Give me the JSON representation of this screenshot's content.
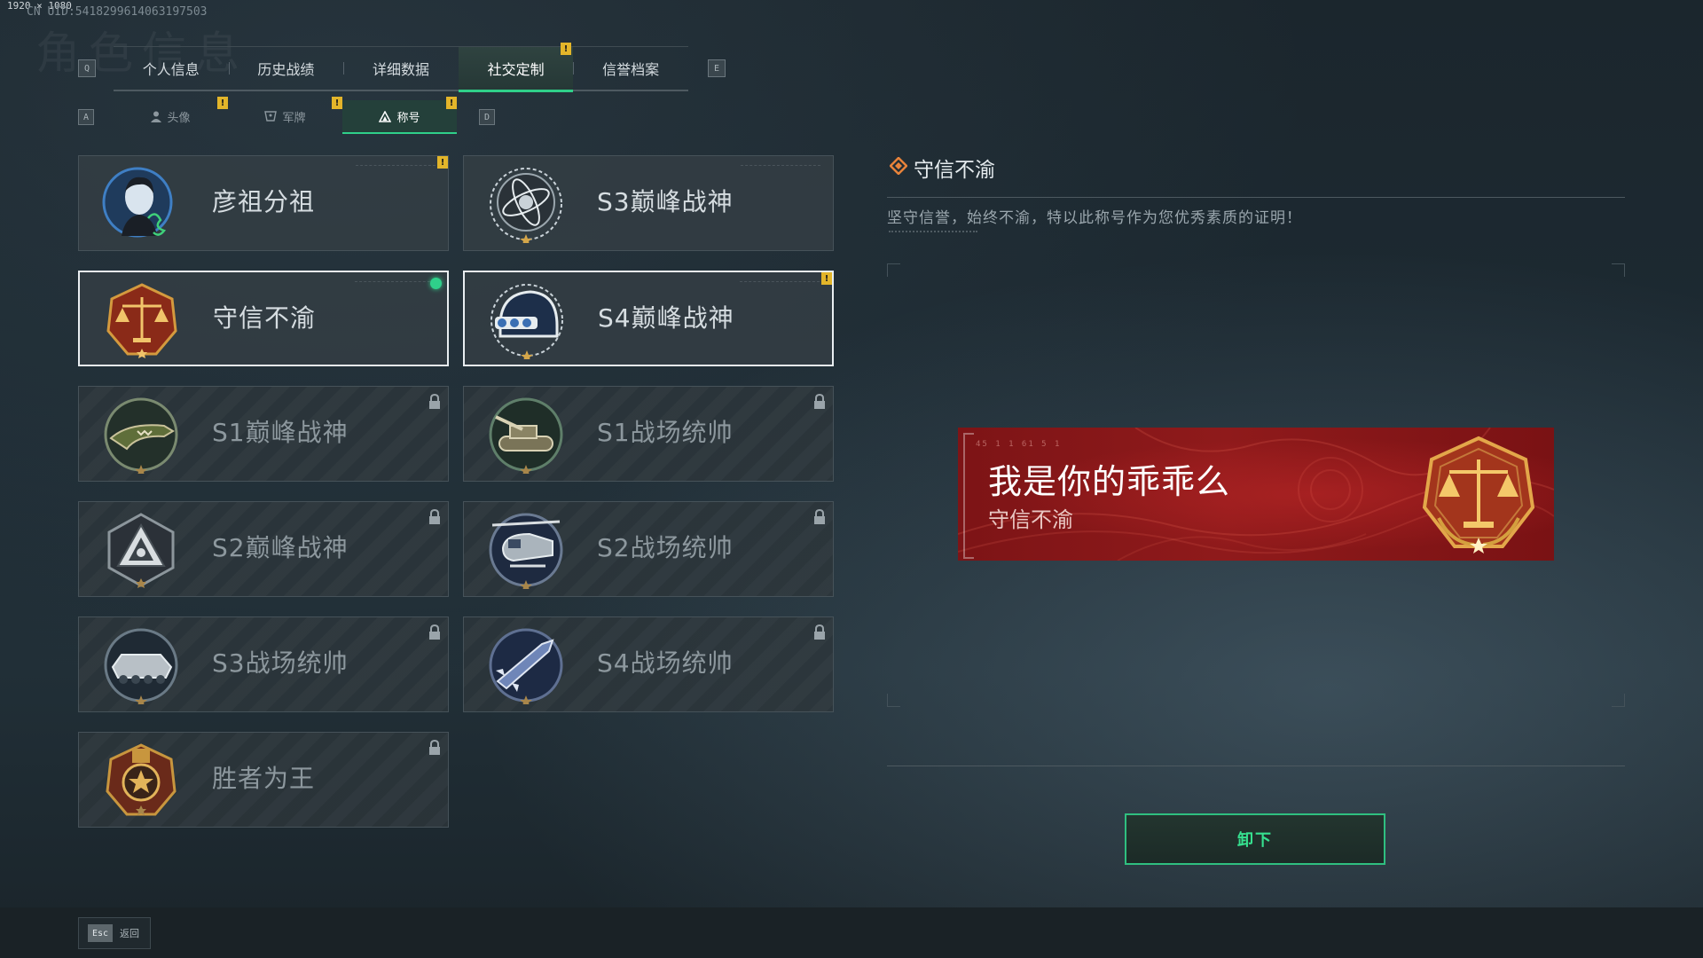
{
  "uid_text": "CN UID:5418299614063197503",
  "resolution_text": "1920 × 1080",
  "bg_title": "角色信息",
  "nav": {
    "prev_key": "Q",
    "next_key": "E",
    "tabs": [
      {
        "label": "个人信息"
      },
      {
        "label": "历史战绩"
      },
      {
        "label": "详细数据"
      },
      {
        "label": "社交定制",
        "active": true,
        "alert": true
      },
      {
        "label": "信誉档案"
      }
    ]
  },
  "subnav": {
    "prev_key": "A",
    "next_key": "D",
    "tabs": [
      {
        "label": "头像",
        "icon": "person-icon",
        "alert": true
      },
      {
        "label": "军牌",
        "icon": "dogtag-icon",
        "alert": true
      },
      {
        "label": "称号",
        "icon": "triangle-icon",
        "active": true,
        "alert": true
      }
    ]
  },
  "titles": [
    {
      "name": "彦祖分祖",
      "emblem": "portrait-signature-emblem",
      "state": "owned",
      "alert": true
    },
    {
      "name": "S3巅峰战神",
      "emblem": "armillary-globe-emblem",
      "state": "owned"
    },
    {
      "name": "守信不渝",
      "emblem": "justice-scales-emblem",
      "state": "equipped"
    },
    {
      "name": "S4巅峰战神",
      "emblem": "night-vision-helmet-emblem",
      "state": "selected",
      "alert": true
    },
    {
      "name": "S1巅峰战神",
      "emblem": "crocodile-emblem",
      "state": "locked"
    },
    {
      "name": "S1战场统帅",
      "emblem": "tank-emblem",
      "state": "locked"
    },
    {
      "name": "S2巅峰战神",
      "emblem": "hazard-triangle-emblem",
      "state": "locked"
    },
    {
      "name": "S2战场统帅",
      "emblem": "helicopter-emblem",
      "state": "locked"
    },
    {
      "name": "S3战场统帅",
      "emblem": "armored-vehicle-emblem",
      "state": "locked"
    },
    {
      "name": "S4战场统帅",
      "emblem": "missile-emblem",
      "state": "locked"
    },
    {
      "name": "胜者为王",
      "emblem": "medal-star-emblem",
      "state": "locked"
    }
  ],
  "detail": {
    "title": "守信不渝",
    "description": "坚守信誉，始终不渝，特以此称号作为您优秀素质的证明！",
    "plate": {
      "player_name": "我是你的乖乖么",
      "subtitle": "守信不渝",
      "code": "45 1 1   61 5 1"
    },
    "action_label": "卸下"
  },
  "footer": {
    "esc_key": "Esc",
    "back_label": "返回"
  },
  "colors": {
    "accent": "#2fd08a",
    "alert": "#e3b52a",
    "plate": "#8f1a1b"
  }
}
